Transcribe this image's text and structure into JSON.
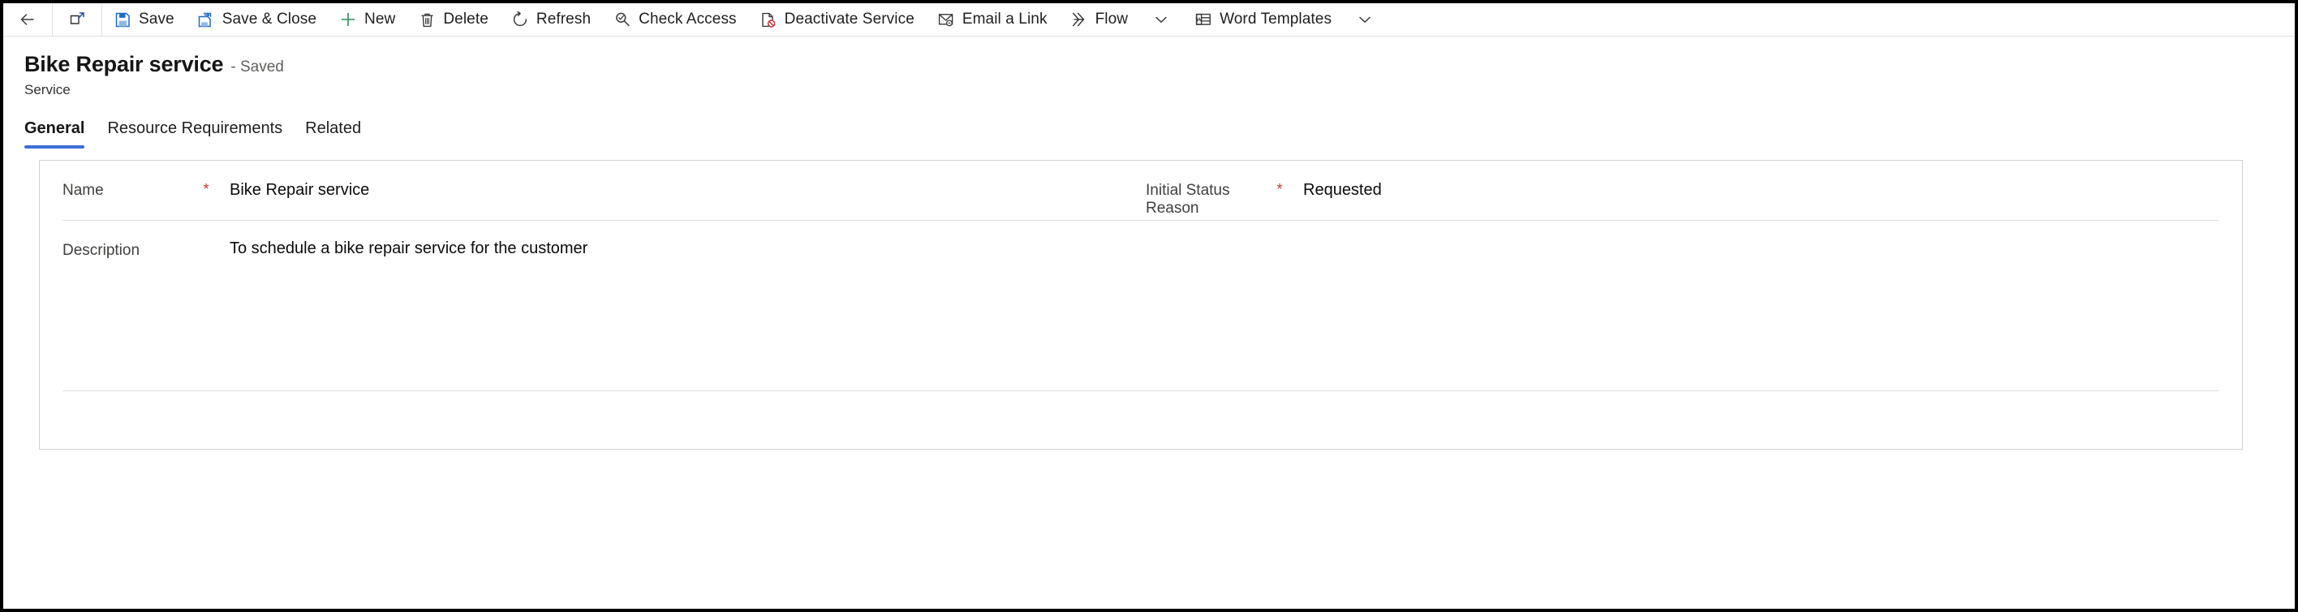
{
  "commandbar": {
    "buttons": [
      {
        "name": "back",
        "icon": "back-arrow-icon",
        "label": ""
      },
      {
        "name": "popout",
        "icon": "open-in-new-window-icon",
        "label": ""
      },
      {
        "name": "save",
        "icon": "save-icon",
        "label": "Save"
      },
      {
        "name": "save-and-close",
        "icon": "save-and-close-icon",
        "label": "Save & Close"
      },
      {
        "name": "new",
        "icon": "plus-icon",
        "label": "New"
      },
      {
        "name": "delete",
        "icon": "trash-icon",
        "label": "Delete"
      },
      {
        "name": "refresh",
        "icon": "refresh-icon",
        "label": "Refresh"
      },
      {
        "name": "check-access",
        "icon": "check-access-icon",
        "label": "Check Access"
      },
      {
        "name": "deactivate-service",
        "icon": "deactivate-icon",
        "label": "Deactivate Service"
      },
      {
        "name": "email-a-link",
        "icon": "email-link-icon",
        "label": "Email a Link"
      },
      {
        "name": "flow",
        "icon": "flow-icon",
        "label": "Flow"
      },
      {
        "name": "word-templates",
        "icon": "word-template-icon",
        "label": "Word Templates"
      }
    ],
    "overflow_chevron": "chevron-down-icon"
  },
  "header": {
    "record_title": "Bike Repair service",
    "saved_status": "- Saved",
    "entity_name": "Service"
  },
  "tabs": [
    {
      "label": "General",
      "active": true
    },
    {
      "label": "Resource Requirements",
      "active": false
    },
    {
      "label": "Related",
      "active": false
    }
  ],
  "form": {
    "name_label": "Name",
    "name_required": "*",
    "name_value": "Bike Repair service",
    "status_label": "Initial Status Reason",
    "status_required": "*",
    "status_value": "Requested",
    "description_label": "Description",
    "description_value": "To schedule a bike repair service for the customer"
  },
  "colors": {
    "accent": "#3b6fd4",
    "required_asterisk": "#c9342a",
    "save_icon": "#1f6ac9",
    "new_icon": "#2e8b57",
    "text_primary": "#201f1e",
    "text_secondary": "#605e5c",
    "border": "#d2d0ce"
  }
}
